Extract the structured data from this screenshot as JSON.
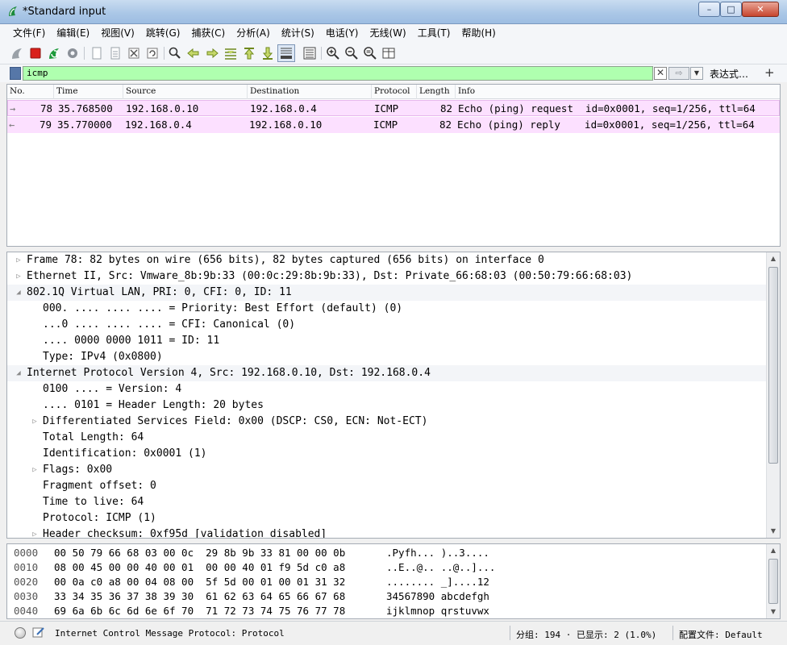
{
  "window": {
    "title": "*Standard input",
    "minimize": "–",
    "maximize": "□",
    "close": "✕"
  },
  "menu": [
    "文件(F)",
    "编辑(E)",
    "视图(V)",
    "跳转(G)",
    "捕获(C)",
    "分析(A)",
    "统计(S)",
    "电话(Y)",
    "无线(W)",
    "工具(T)",
    "帮助(H)"
  ],
  "toolbar_icons": [
    "shark-start-icon",
    "stop-icon",
    "restart-icon",
    "options-gear-icon",
    "open-file-icon",
    "binary-file-icon",
    "close-file-icon",
    "reload-icon",
    "find-icon",
    "back-arrow-icon",
    "forward-arrow-icon",
    "go-to-packet-icon",
    "first-packet-icon",
    "last-packet-icon",
    "autoscroll-icon",
    "colorize-icon",
    "zoom-in-icon",
    "zoom-out-icon",
    "normal-size-icon",
    "resize-columns-icon"
  ],
  "filter": {
    "value": "icmp",
    "clear_glyph": "✕",
    "apply_glyph": "⇨",
    "dropdown_glyph": "▼",
    "expressions_label": "表达式…",
    "add_glyph": "+"
  },
  "packet_list": {
    "columns": [
      "No.",
      "Time",
      "Source",
      "Destination",
      "Protocol",
      "Length",
      "Info"
    ],
    "rows": [
      {
        "no": "78",
        "time": "35.768500",
        "source": "192.168.0.10",
        "destination": "192.168.0.4",
        "protocol": "ICMP",
        "length": "82",
        "info": "Echo (ping) request  id=0x0001, seq=1/256, ttl=64",
        "arrow": "→"
      },
      {
        "no": "79",
        "time": "35.770000",
        "source": "192.168.0.4",
        "destination": "192.168.0.10",
        "protocol": "ICMP",
        "length": "82",
        "info": "Echo (ping) reply    id=0x0001, seq=1/256, ttl=64",
        "arrow": "←"
      }
    ]
  },
  "details": [
    {
      "text": "Frame 78: 82 bytes on wire (656 bits), 82 bytes captured (656 bits) on interface 0",
      "indent": 0,
      "expander": "▷"
    },
    {
      "text": "Ethernet II, Src: Vmware_8b:9b:33 (00:0c:29:8b:9b:33), Dst: Private_66:68:03 (00:50:79:66:68:03)",
      "indent": 0,
      "expander": "▷"
    },
    {
      "text": "802.1Q Virtual LAN, PRI: 0, CFI: 0, ID: 11",
      "indent": 0,
      "expander": "◢"
    },
    {
      "text": "000. .... .... .... = Priority: Best Effort (default) (0)",
      "indent": 1,
      "expander": ""
    },
    {
      "text": "...0 .... .... .... = CFI: Canonical (0)",
      "indent": 1,
      "expander": ""
    },
    {
      "text": ".... 0000 0000 1011 = ID: 11",
      "indent": 1,
      "expander": ""
    },
    {
      "text": "Type: IPv4 (0x0800)",
      "indent": 1,
      "expander": ""
    },
    {
      "text": "Internet Protocol Version 4, Src: 192.168.0.10, Dst: 192.168.0.4",
      "indent": 0,
      "expander": "◢"
    },
    {
      "text": "0100 .... = Version: 4",
      "indent": 1,
      "expander": ""
    },
    {
      "text": ".... 0101 = Header Length: 20 bytes",
      "indent": 1,
      "expander": ""
    },
    {
      "text": "Differentiated Services Field: 0x00 (DSCP: CS0, ECN: Not-ECT)",
      "indent": 1,
      "expander": "▷"
    },
    {
      "text": "Total Length: 64",
      "indent": 1,
      "expander": ""
    },
    {
      "text": "Identification: 0x0001 (1)",
      "indent": 1,
      "expander": ""
    },
    {
      "text": "Flags: 0x00",
      "indent": 1,
      "expander": "▷"
    },
    {
      "text": "Fragment offset: 0",
      "indent": 1,
      "expander": ""
    },
    {
      "text": "Time to live: 64",
      "indent": 1,
      "expander": ""
    },
    {
      "text": "Protocol: ICMP (1)",
      "indent": 1,
      "expander": ""
    },
    {
      "text": "Header checksum: 0xf95d [validation disabled]",
      "indent": 1,
      "expander": "▷"
    }
  ],
  "bytes": [
    {
      "offset": "0000",
      "hex": "00 50 79 66 68 03 00 0c  29 8b 9b 33 81 00 00 0b",
      "ascii": ".Pyfh... )..3...."
    },
    {
      "offset": "0010",
      "hex": "08 00 45 00 00 40 00 01  00 00 40 01 f9 5d c0 a8",
      "ascii": "..E..@.. ..@..]..."
    },
    {
      "offset": "0020",
      "hex": "00 0a c0 a8 00 04 08 00  5f 5d 00 01 00 01 31 32",
      "ascii": "........ _]....12"
    },
    {
      "offset": "0030",
      "hex": "33 34 35 36 37 38 39 30  61 62 63 64 65 66 67 68",
      "ascii": "34567890 abcdefgh"
    },
    {
      "offset": "0040",
      "hex": "69 6a 6b 6c 6d 6e 6f 70  71 72 73 74 75 76 77 78",
      "ascii": "ijklmnop qrstuvwx"
    }
  ],
  "status": {
    "text": "Internet Control Message Protocol: Protocol",
    "packets": "分组: 194 · 已显示: 2 (1.0%)",
    "profile": "配置文件: Default"
  },
  "colors": {
    "icmp_row": "#fce0ff",
    "filter_ok": "#afffaf"
  }
}
